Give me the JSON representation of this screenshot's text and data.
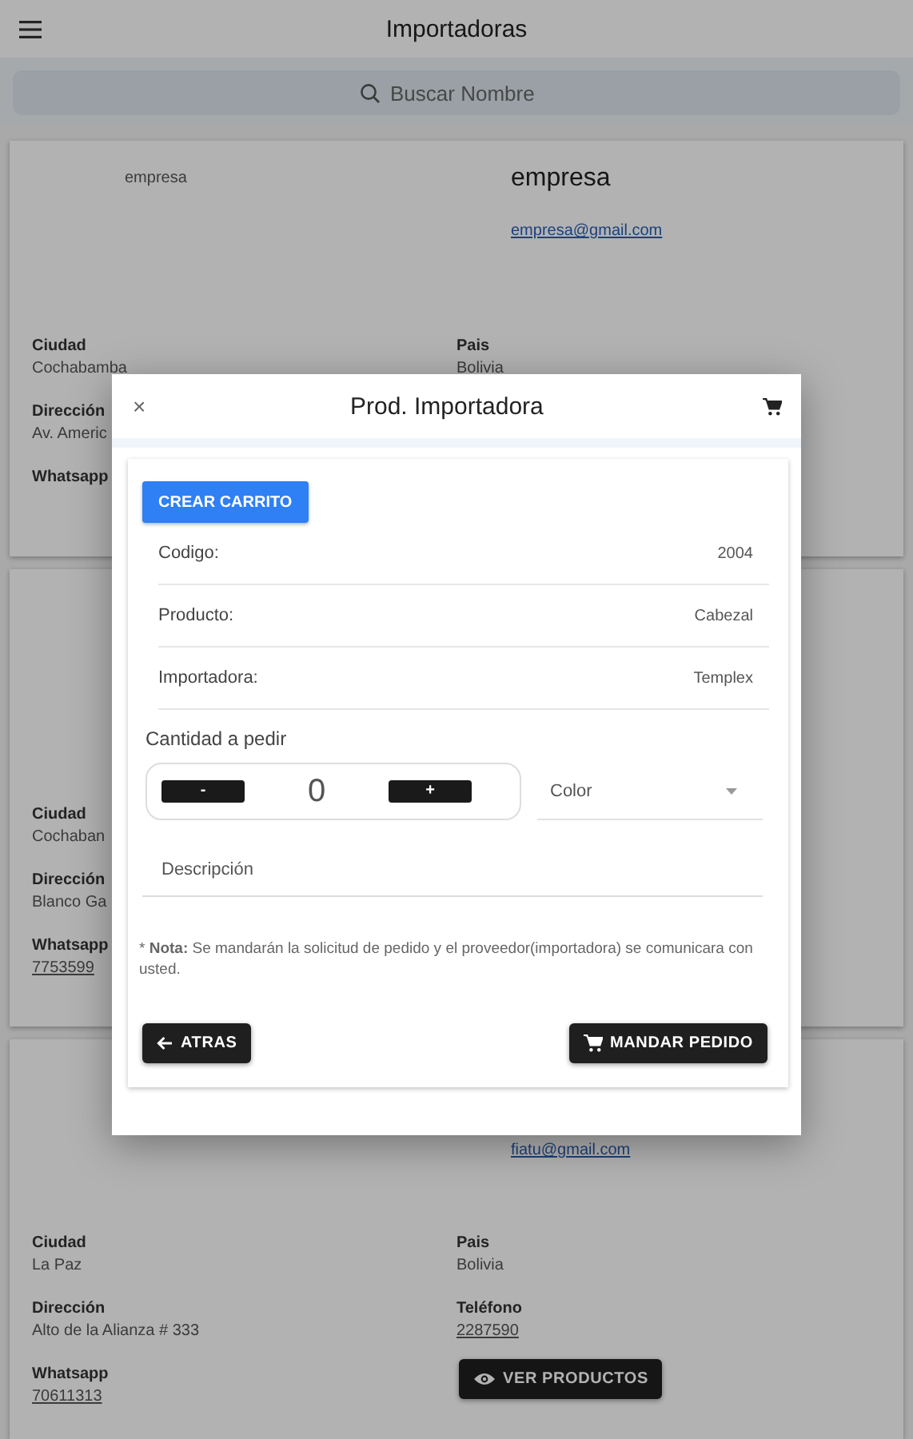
{
  "app_bar": {
    "title": "Importadoras"
  },
  "search": {
    "placeholder": "Buscar Nombre"
  },
  "cards": [
    {
      "logo_alt": "empresa",
      "name": "empresa",
      "email": "empresa@gmail.com",
      "left": [
        {
          "label": "Ciudad",
          "value": "Cochabamba",
          "kind": "text"
        },
        {
          "label": "Dirección",
          "value": "Av. Americ",
          "kind": "text"
        },
        {
          "label": "Whatsapp"
        }
      ],
      "right": [
        {
          "label": "Pais",
          "value": "Bolivia",
          "kind": "text"
        }
      ]
    },
    {
      "left": [
        {
          "label": "Ciudad",
          "value": "Cochaban",
          "kind": "text"
        },
        {
          "label": "Dirección",
          "value": "Blanco Ga",
          "kind": "text"
        },
        {
          "label": "Whatsapp",
          "value": "7753599",
          "kind": "link"
        }
      ]
    },
    {
      "email": "fiatu@gmail.com",
      "left": [
        {
          "label": "Ciudad",
          "value": "La Paz",
          "kind": "text"
        },
        {
          "label": "Dirección",
          "value": "Alto de la Alianza # 333",
          "kind": "text"
        },
        {
          "label": "Whatsapp",
          "value": "70611313",
          "kind": "link"
        }
      ],
      "right": [
        {
          "label": "Pais",
          "value": "Bolivia",
          "kind": "text"
        },
        {
          "label": "Teléfono",
          "value": "2287590",
          "kind": "link"
        }
      ],
      "button": "VER PRODUCTOS"
    }
  ],
  "modal": {
    "close": "×",
    "title": "Prod. Importadora",
    "create_cart": "CREAR CARRITO",
    "details": [
      {
        "label": "Codigo:",
        "value": "2004"
      },
      {
        "label": "Producto:",
        "value": "Cabezal"
      },
      {
        "label": "Importadora:",
        "value": "Templex"
      }
    ],
    "quantity_label": "Cantidad a pedir",
    "minus": "-",
    "quantity": "0",
    "plus": "+",
    "color": {
      "placeholder": "Color"
    },
    "description": {
      "placeholder": "Descripción"
    },
    "note": "* **Nota:**  Se mandarán la solicitud de pedido y el proveedor(importadora) se comunicara con usted.",
    "back": "ATRAS",
    "send": "MANDAR PEDIDO"
  }
}
